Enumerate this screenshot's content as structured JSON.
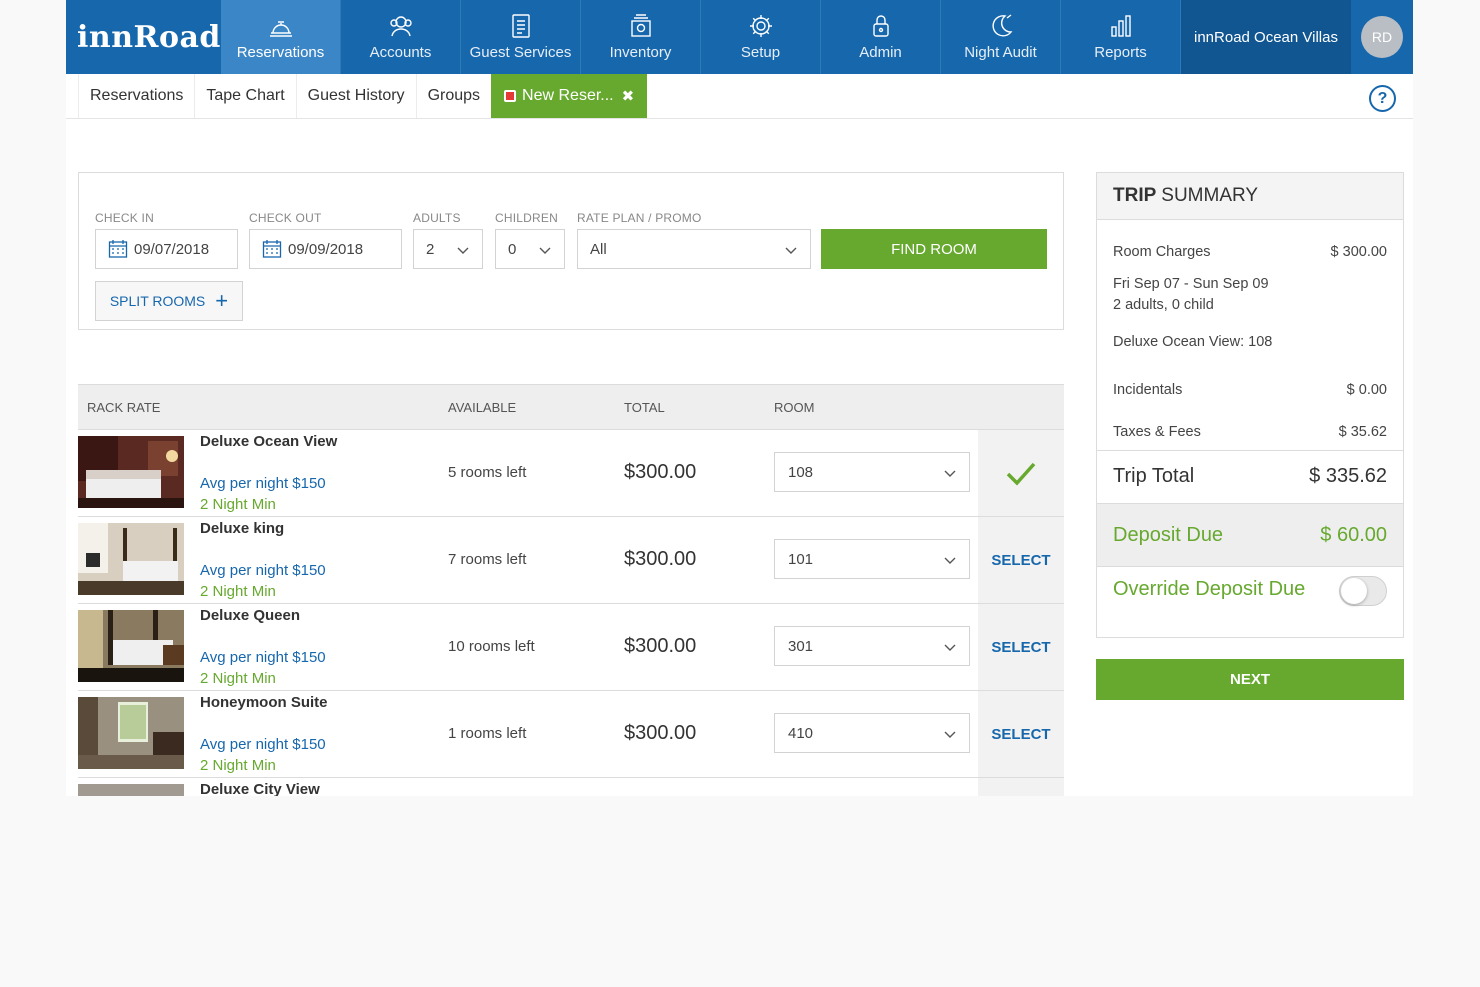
{
  "app": {
    "logo": "innRoad",
    "nav": [
      {
        "label": "Reservations",
        "icon": "concierge-bell-icon"
      },
      {
        "label": "Accounts",
        "icon": "users-icon"
      },
      {
        "label": "Guest Services",
        "icon": "clipboard-icon"
      },
      {
        "label": "Inventory",
        "icon": "money-stack-icon"
      },
      {
        "label": "Setup",
        "icon": "gear-icon"
      },
      {
        "label": "Admin",
        "icon": "lock-icon"
      },
      {
        "label": "Night Audit",
        "icon": "moon-icon"
      },
      {
        "label": "Reports",
        "icon": "bar-chart-icon"
      }
    ],
    "property": "innRoad Ocean Villas",
    "user_initials": "RD"
  },
  "subnav": {
    "tabs": [
      "Reservations",
      "Tape Chart",
      "Guest History",
      "Groups"
    ],
    "new_tab": "New Reser...",
    "help": "?"
  },
  "search": {
    "checkin_label": "CHECK IN",
    "checkin_value": "09/07/2018",
    "checkout_label": "CHECK OUT",
    "checkout_value": "09/09/2018",
    "adults_label": "ADULTS",
    "adults_value": "2",
    "children_label": "CHILDREN",
    "children_value": "0",
    "rateplan_label": "RATE PLAN / PROMO",
    "rateplan_value": "All",
    "find_button": "FIND ROOM",
    "split_button": "SPLIT ROOMS",
    "split_plus": "+"
  },
  "results": {
    "headers": {
      "rack_rate": "RACK RATE",
      "available": "AVAILABLE",
      "total": "TOTAL",
      "room": "ROOM"
    },
    "rows": [
      {
        "name": "Deluxe Ocean View",
        "avg": "Avg per night $150",
        "min": "2 Night Min",
        "available": "5 rooms left",
        "total": "$300.00",
        "room": "108",
        "action": "",
        "selected": true
      },
      {
        "name": "Deluxe king",
        "avg": "Avg per night $150",
        "min": "2 Night Min",
        "available": "7 rooms left",
        "total": "$300.00",
        "room": "101",
        "action": "SELECT",
        "selected": false
      },
      {
        "name": "Deluxe Queen",
        "avg": "Avg per night $150",
        "min": "2 Night Min",
        "available": "10 rooms left",
        "total": "$300.00",
        "room": "301",
        "action": "SELECT",
        "selected": false
      },
      {
        "name": "Honeymoon Suite",
        "avg": "Avg per night $150",
        "min": "2 Night Min",
        "available": "1 rooms left",
        "total": "$300.00",
        "room": "410",
        "action": "SELECT",
        "selected": false
      },
      {
        "name": "Deluxe City View",
        "avg": "",
        "min": "",
        "available": "",
        "total": "",
        "room": "",
        "action": "",
        "selected": false
      }
    ]
  },
  "summary": {
    "title_bold": "TRIP",
    "title_rest": "SUMMARY",
    "room_charges_label": "Room Charges",
    "room_charges_value": "$ 300.00",
    "dates": "Fri Sep 07 - Sun Sep 09",
    "guests": "2 adults, 0 child",
    "room_desc": "Deluxe Ocean View: 108",
    "incidentals_label": "Incidentals",
    "incidentals_value": "$ 0.00",
    "taxes_label": "Taxes & Fees",
    "taxes_value": "$ 35.62",
    "trip_total_label": "Trip Total",
    "trip_total_value": "$ 335.62",
    "deposit_label": "Deposit Due",
    "deposit_value": "$ 60.00",
    "override_label": "Override Deposit Due",
    "override_on": false
  },
  "next_button": "NEXT",
  "colors": {
    "brand_blue": "#1767ad",
    "accent_green": "#67a92f"
  }
}
